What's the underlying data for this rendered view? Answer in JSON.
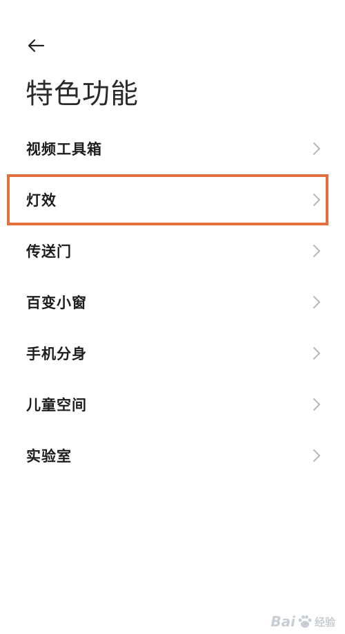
{
  "header": {
    "back_icon": "arrow-left-icon",
    "title": "特色功能"
  },
  "menu": {
    "items": [
      {
        "label": "视频工具箱",
        "icon": "chevron-right-icon"
      },
      {
        "label": "灯效",
        "icon": "chevron-right-icon",
        "highlighted": true
      },
      {
        "label": "传送门",
        "icon": "chevron-right-icon"
      },
      {
        "label": "百变小窗",
        "icon": "chevron-right-icon"
      },
      {
        "label": "手机分身",
        "icon": "chevron-right-icon"
      },
      {
        "label": "儿童空间",
        "icon": "chevron-right-icon"
      },
      {
        "label": "实验室",
        "icon": "chevron-right-icon"
      }
    ]
  },
  "annotation": {
    "highlight_color": "#e2703f"
  },
  "watermark": {
    "brand": "Bai",
    "suffix": "经验"
  }
}
